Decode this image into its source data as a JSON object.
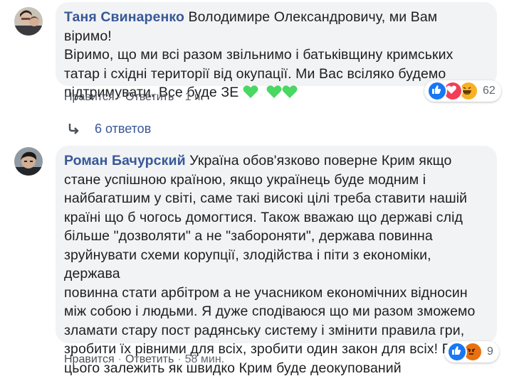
{
  "comments": [
    {
      "author": "Таня Свинаренко",
      "lines": [
        "Володимире Олександровичу, ми Вам віримо!",
        "Віримо, що ми всі разом звільнимо і батьківщину кримських",
        "татар і східні території від окупації. Ми Вас всіляко будемо",
        "підтримувати. Все буде ЗЕ"
      ],
      "like_label": "Нравится",
      "reply_label": "Ответить",
      "time": "1 ч.",
      "reaction_icons": [
        "like-icon",
        "love-icon",
        "haha-icon"
      ],
      "reaction_count": "62"
    },
    {
      "author": "Роман Бачурский",
      "lines": [
        "Україна обов'язково поверне Крим якщо",
        "стане успішною країною, якщо українець буде модним і",
        "найбагатшим у світі, саме такі високі цілі треба ставити нашій",
        "країні що б чогось домогтися. Також вважаю що державі слід",
        "більше \"дозволяти\" а не \"забороняти\", держава повинна",
        "зруйнувати схеми корупції, злодійства і піти з економіки, держава",
        "повинна стати арбітром а не учасником економічних відносин",
        "між собою і людьми. Я дуже сподіваюся що ми разом зможемо",
        "зламати стару пост радянську систему і змінити правила гри,",
        "зробити їх рівними для всіх, зробити один закон для всіх! Від",
        "цього залежить як швидко Крим буде деокупований"
      ],
      "like_label": "Нравится",
      "reply_label": "Ответить",
      "time": "58 мин.",
      "reaction_icons": [
        "like-icon",
        "angry-icon"
      ],
      "reaction_count": "9"
    }
  ],
  "replies_link": "6 ответов",
  "colors": {
    "author": "#385898",
    "bubble": "#f2f3f5",
    "heart": "#4bd763"
  }
}
